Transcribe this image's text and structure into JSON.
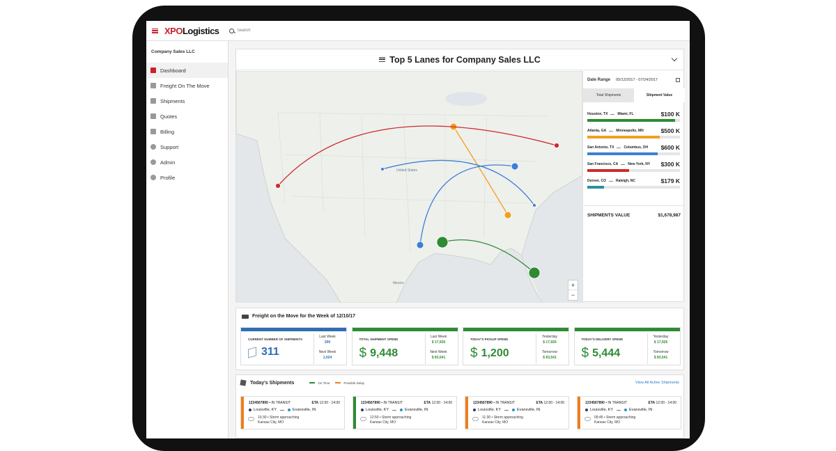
{
  "app": {
    "logo_xpo": "XPO",
    "logo_logistics": "Logistics",
    "search_placeholder": "Search"
  },
  "sidebar": {
    "company": "Company Sales LLC",
    "items": [
      {
        "label": "Dashboard",
        "icon": "dashboard-icon",
        "active": true
      },
      {
        "label": "Freight On The Move",
        "icon": "truck-icon"
      },
      {
        "label": "Shipments",
        "icon": "box-icon"
      },
      {
        "label": "Quotes",
        "icon": "quote-icon"
      },
      {
        "label": "Billing",
        "icon": "billing-icon"
      },
      {
        "label": "Support",
        "icon": "help-icon"
      },
      {
        "label": "Admin",
        "icon": "gear-icon"
      },
      {
        "label": "Profile",
        "icon": "user-icon"
      }
    ]
  },
  "lanes_panel": {
    "title": "Top 5 Lanes for Company Sales LLC",
    "map_label": "United States",
    "map_label_2": "Mexico",
    "date_range_label": "Date Range",
    "date_range_value": "05/12/2017 - 07/24/2017",
    "tab_total": "Total Shipments",
    "tab_value": "Shipment Value",
    "lanes": [
      {
        "from": "Houston, TX",
        "to": "Miami, FL",
        "value": "$100 K",
        "fill": 0.95,
        "color": "#2e8b34"
      },
      {
        "from": "Atlanta, GA",
        "to": "Minneapolis, MN",
        "value": "$500 K",
        "fill": 0.78,
        "color": "#f0a020"
      },
      {
        "from": "San Antonio, TX",
        "to": "Columbus, OH",
        "value": "$600 K",
        "fill": 0.76,
        "color": "#3d7fd6"
      },
      {
        "from": "San Francisco, CA",
        "to": "New York, NY",
        "value": "$300 K",
        "fill": 0.45,
        "color": "#cc2b2b"
      },
      {
        "from": "Denver, CO",
        "to": "Raleigh, NC",
        "value": "$179 K",
        "fill": 0.18,
        "color": "#2a8fa0"
      }
    ],
    "total_label": "SHIPMENTS VALUE",
    "total_value": "$1,678,987"
  },
  "freight": {
    "title": "Freight on the Move for the Week of 12/10/17",
    "cards": [
      {
        "label": "CURRENT NUMBER OF SHIPMENTS",
        "value": "311",
        "currency": false,
        "color": "#2f6db5",
        "r1_label": "Last Week",
        "r1_value": "200",
        "r2_label": "Next Week",
        "r2_value": "1,024",
        "sub_color": "#2f6db5"
      },
      {
        "label": "TOTAL SHIPMENT SPEND",
        "value": "9,448",
        "currency": true,
        "color": "#2e8b34",
        "r1_label": "Last Week",
        "r1_value": "$ 17,926",
        "r2_label": "Next Week",
        "r2_value": "$ 83,541",
        "sub_color": "#2e8b34"
      },
      {
        "label": "TODAY'S PICKUP SPEND",
        "value": "1,200",
        "currency": true,
        "color": "#2e8b34",
        "r1_label": "Yesterday",
        "r1_value": "$ 17,926",
        "r2_label": "Tomorrow",
        "r2_value": "$ 83,541",
        "sub_color": "#2e8b34"
      },
      {
        "label": "TODAY'S DELIVERY SPEND",
        "value": "5,444",
        "currency": true,
        "color": "#2e8b34",
        "r1_label": "Yesterday",
        "r1_value": "$ 17,926",
        "r2_label": "Tomorrow",
        "r2_value": "$ 83,541",
        "sub_color": "#2e8b34"
      }
    ]
  },
  "today": {
    "title": "Today's Shipments",
    "legend_on_time": "On Time",
    "legend_delay": "Possible Delay",
    "view_all": "View All Active Shipments",
    "shipments": [
      {
        "id": "1234567890",
        "status": "IN TRANSIT",
        "eta_label": "ETA",
        "eta": "12:00 - 14:00",
        "from": "Louisville, KY",
        "to": "Evansville, IN",
        "note_time": "10:30",
        "note": "Storm approaching",
        "location": "Kansas City, MO",
        "stripe": "#f07d1a"
      },
      {
        "id": "1234567890",
        "status": "IN TRANSIT",
        "eta_label": "ETA",
        "eta": "12:00 - 14:00",
        "from": "Louisville, KY",
        "to": "Evansville, IN",
        "note_time": "12:50",
        "note": "Storm approaching",
        "location": "Kansas City, MO",
        "stripe": "#2e8b34"
      },
      {
        "id": "1234567890",
        "status": "IN TRANSIT",
        "eta_label": "ETA",
        "eta": "12:00 - 14:00",
        "from": "Louisville, KY",
        "to": "Evansville, IN",
        "note_time": "11:30",
        "note": "Storm approaching",
        "location": "Kansas City, MO",
        "stripe": "#f07d1a"
      },
      {
        "id": "1234567890",
        "status": "IN TRANSIT",
        "eta_label": "ETA",
        "eta": "12:00 - 14:00",
        "from": "Louisville, KY",
        "to": "Evansville, IN",
        "note_time": "09:45",
        "note": "Storm approaching",
        "location": "Kansas City, MO",
        "stripe": "#f07d1a"
      }
    ]
  },
  "colors": {
    "brand_red": "#cc1f2f",
    "blue": "#2f6db5",
    "green": "#2e8b34",
    "orange": "#f07d1a",
    "link": "#2a7cc7"
  },
  "map_zoom": {
    "plus": "+",
    "minus": "−"
  }
}
